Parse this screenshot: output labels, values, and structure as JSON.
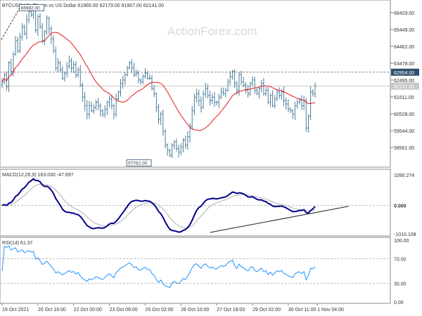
{
  "chart_data": [
    {
      "type": "ohlc",
      "panel": "price",
      "header": "BTCUSD,H1:  Bitcoin vs US Dollar  61965.00 62179.00 61907.00 62141.00",
      "watermark": "ActionForex.com",
      "ylim": [
        57500,
        67000
      ],
      "y_ticks": [
        "66429.00",
        "65449.00",
        "64462.00",
        "63478.00",
        "62495.00",
        "61511.00",
        "60528.00",
        "59544.00",
        "58561.00"
      ],
      "y_tick_values": [
        66429,
        65449,
        64462,
        63478,
        62495,
        61511,
        60528,
        59544,
        58561
      ],
      "price_labels": [
        {
          "text": "62954.00",
          "value": 62954,
          "style": "dark"
        },
        {
          "text": "62141.00",
          "value": 62141,
          "style": "light"
        }
      ],
      "annotations": [
        {
          "text": "66982.00",
          "x": 9,
          "value": 66982
        },
        {
          "text": "57762.00",
          "x": 62,
          "value": 57762
        }
      ],
      "x_count": 141,
      "close": [
        62400,
        62800,
        62100,
        63500,
        63000,
        64000,
        64800,
        64200,
        65000,
        65600,
        65200,
        66000,
        66500,
        66300,
        66700,
        65400,
        66200,
        65600,
        64800,
        65300,
        66100,
        65500,
        64900,
        64200,
        63200,
        63500,
        63100,
        62600,
        62900,
        63300,
        63600,
        63200,
        63400,
        62800,
        63100,
        62200,
        61500,
        61000,
        60500,
        61000,
        60700,
        60900,
        61200,
        61000,
        60700,
        60500,
        60800,
        61200,
        61400,
        61000,
        60500,
        61400,
        61800,
        62300,
        62500,
        62800,
        63200,
        63500,
        63200,
        62800,
        62900,
        62500,
        62400,
        62700,
        62900,
        62600,
        62600,
        62000,
        61700,
        60900,
        60200,
        60500,
        59500,
        58700,
        58400,
        58100,
        58700,
        58900,
        58500,
        58300,
        58600,
        59000,
        58700,
        59200,
        59800,
        60700,
        61500,
        61700,
        61300,
        60900,
        61700,
        62000,
        61600,
        61300,
        61500,
        61200,
        61200,
        61500,
        61800,
        61700,
        61900,
        62400,
        62700,
        63000,
        62300,
        61900,
        62800,
        62400,
        62200,
        61900,
        61700,
        62300,
        62500,
        61900,
        61700,
        62000,
        62300,
        61700,
        61900,
        61200,
        61600,
        61000,
        61400,
        61800,
        61600,
        61800,
        61300,
        61100,
        60800,
        60700,
        60500,
        61000,
        61200,
        61300,
        61000,
        61300,
        59700,
        60400,
        61800,
        61700,
        62141
      ],
      "ma_series": [
        {
          "color": "#e31a1c"
        }
      ]
    },
    {
      "type": "line",
      "panel": "macd",
      "header": "MACD(12,26,9) 163.030 -47.697",
      "ylim": [
        -1010.108,
        1090.274
      ],
      "y_ticks": [
        "1090.274",
        "0.000",
        "-1010.108"
      ],
      "y_tick_values": [
        1090.274,
        0,
        -1010.108
      ],
      "trendline": {
        "from": [
          93,
          -960
        ],
        "to": [
          155,
          -30
        ]
      },
      "series": [
        {
          "color": "#00008b"
        },
        {
          "color": "#b0b0b0"
        }
      ]
    },
    {
      "type": "line",
      "panel": "rsi",
      "header": "RSI(14) 61.37",
      "ylim": [
        0,
        100
      ],
      "y_ticks": [
        "100.00",
        "70.00",
        "30.00",
        "0.00"
      ],
      "y_tick_values": [
        100,
        70,
        30,
        0
      ],
      "levels": [
        70,
        30
      ],
      "series": [
        {
          "color": "#1e90ff"
        }
      ]
    }
  ],
  "time_axis": {
    "labels": [
      "19 Oct 2021",
      "20 Oct 16:00",
      "22 Oct 00:00",
      "23 Oct 09:00",
      "25 Oct 02:00",
      "26 Oct 10:00",
      "27 Oct 18:00",
      "29 Oct 02:00",
      "30 Oct 11:00",
      "1 Nov 04:00"
    ],
    "x_index": [
      0,
      16,
      32,
      48,
      64,
      80,
      96,
      112,
      128,
      141
    ]
  },
  "colors": {
    "bars": "#4a7c9a",
    "grid": "#bbbbbb",
    "text": "#333333",
    "rsi": "#1e90ff",
    "macd": "#00008b",
    "signal": "#b0b0b0",
    "ma": "#e31a1c"
  }
}
